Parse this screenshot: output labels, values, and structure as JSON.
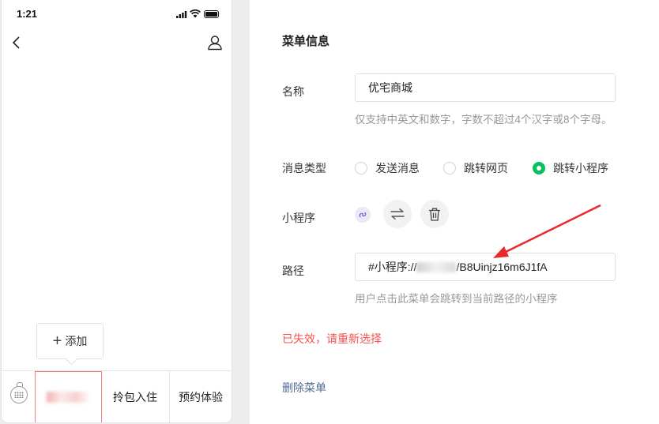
{
  "status_bar": {
    "time": "1:21"
  },
  "preview": {
    "add_label": "添加",
    "menu": [
      {
        "label": "优宅商城",
        "selected": true
      },
      {
        "label": "拎包入住",
        "selected": false
      },
      {
        "label": "预约体验",
        "selected": false
      }
    ]
  },
  "panel": {
    "title": "菜单信息",
    "name_label": "名称",
    "name_value": "优宅商城",
    "name_hint": "仅支持中英文和数字，字数不超过4个汉字或8个字母。",
    "msgtype_label": "消息类型",
    "msgtype_options": [
      {
        "label": "发送消息",
        "checked": false
      },
      {
        "label": "跳转网页",
        "checked": false
      },
      {
        "label": "跳转小程序",
        "checked": true
      }
    ],
    "miniprogram_label": "小程序",
    "path_label": "路径",
    "path_prefix": "#小程序://",
    "path_suffix": "/B8Uinjz16m6J1fA",
    "path_hint": "用户点击此菜单会跳转到当前路径的小程序",
    "error_text": "已失效，请重新选择",
    "delete_label": "删除菜单"
  },
  "colors": {
    "accent_green": "#07c160",
    "error_red": "#fa5151",
    "link_blue": "#576b95",
    "arrow_red": "#e8282b"
  }
}
